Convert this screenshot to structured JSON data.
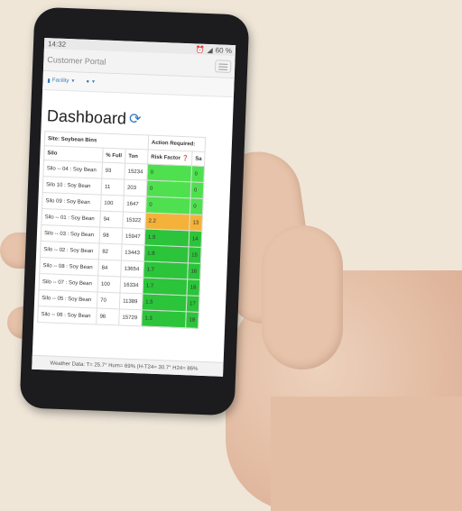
{
  "status": {
    "time": "14:32",
    "battery": "60 %"
  },
  "header": {
    "brand": "Customer Portal"
  },
  "nav": {
    "facility_label": "Facility"
  },
  "page": {
    "title": "Dashboard"
  },
  "table": {
    "site_label": "Site: Soybean Bins",
    "action_label": "Action Required:",
    "columns": [
      "Silo",
      "% Full",
      "Ton",
      "Risk Factor",
      "Sa"
    ],
    "rows": [
      {
        "silo": "Silo -- 04 : Soy Bean",
        "full": "93",
        "ton": "15234",
        "risk": "0",
        "sa": "0",
        "color": "#4fe04f"
      },
      {
        "silo": "Silo 10 : Soy Bean",
        "full": "11",
        "ton": "203",
        "risk": "0",
        "sa": "0",
        "color": "#4fe04f"
      },
      {
        "silo": "Silo 09 : Soy Bean",
        "full": "100",
        "ton": "1647",
        "risk": "0",
        "sa": "0",
        "color": "#4fe04f"
      },
      {
        "silo": "Silo -- 01 : Soy Bean",
        "full": "94",
        "ton": "15322",
        "risk": "2.2",
        "sa": "13",
        "color": "#f4b23a"
      },
      {
        "silo": "Silo -- 03 : Soy Bean",
        "full": "98",
        "ton": "15947",
        "risk": "1.9",
        "sa": "14",
        "color": "#2cc43a"
      },
      {
        "silo": "Silo -- 02 : Soy Bean",
        "full": "82",
        "ton": "13443",
        "risk": "1.8",
        "sa": "15",
        "color": "#2cc43a"
      },
      {
        "silo": "Silo -- 08 : Soy Bean",
        "full": "84",
        "ton": "13654",
        "risk": "1.7",
        "sa": "16",
        "color": "#2cc43a"
      },
      {
        "silo": "Silo -- 07 : Soy Bean",
        "full": "100",
        "ton": "16334",
        "risk": "1.7",
        "sa": "16",
        "color": "#2cc43a"
      },
      {
        "silo": "Silo -- 05 : Soy Bean",
        "full": "70",
        "ton": "11389",
        "risk": "1.5",
        "sa": "17",
        "color": "#2cc43a"
      },
      {
        "silo": "Silo -- 06 : Soy Bean",
        "full": "96",
        "ton": "15729",
        "risk": "1.3",
        "sa": "18",
        "color": "#2cc43a"
      }
    ]
  },
  "weather": {
    "text": "Weather Data: T= 25.7° Hum= 69% (H-T24= 30.7° H24= 86%"
  },
  "icons": {
    "facility": "building-icon",
    "user": "user-icon",
    "refresh": "refresh-icon",
    "help": "question-circle-icon"
  }
}
